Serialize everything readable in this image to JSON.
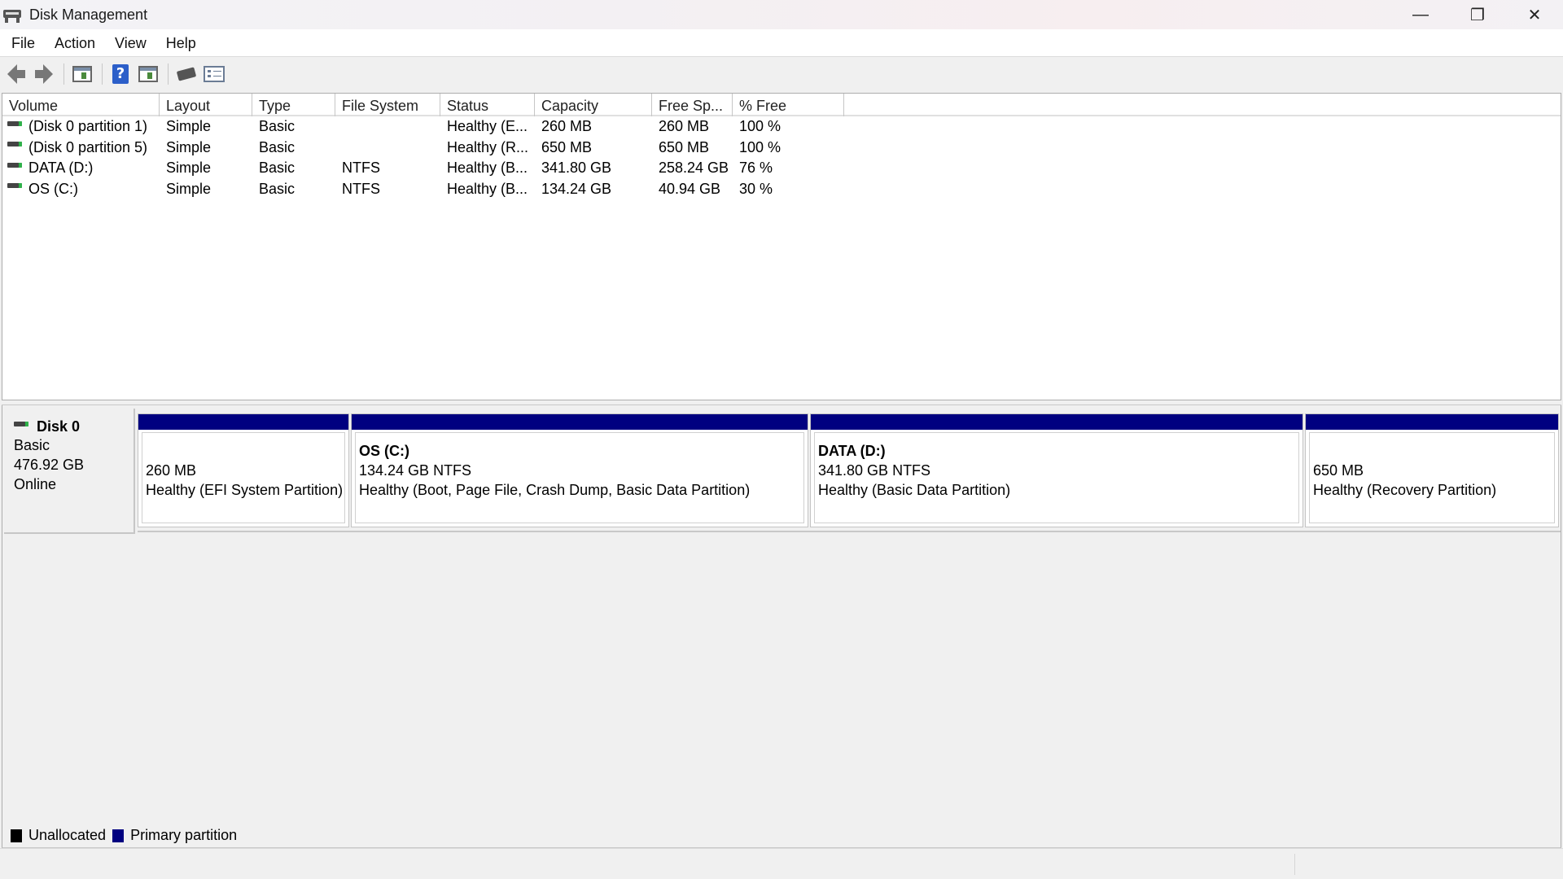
{
  "window": {
    "title": "Disk Management",
    "controls": {
      "minimize": "—",
      "restore": "❐",
      "close": "✕"
    }
  },
  "menu": [
    "File",
    "Action",
    "View",
    "Help"
  ],
  "toolbar": {
    "icons": [
      "back-arrow-icon",
      "forward-arrow-icon",
      "show-hide-console-tree-icon",
      "help-icon",
      "show-action-pane-icon",
      "connect-disk-icon",
      "properties-icon"
    ]
  },
  "volume_list": {
    "columns": [
      "Volume",
      "Layout",
      "Type",
      "File System",
      "Status",
      "Capacity",
      "Free Sp...",
      "% Free"
    ],
    "rows": [
      [
        "(Disk 0 partition 1)",
        "Simple",
        "Basic",
        "",
        "Healthy (E...",
        "260 MB",
        "260 MB",
        "100 %"
      ],
      [
        "(Disk 0 partition 5)",
        "Simple",
        "Basic",
        "",
        "Healthy (R...",
        "650 MB",
        "650 MB",
        "100 %"
      ],
      [
        "DATA (D:)",
        "Simple",
        "Basic",
        "NTFS",
        "Healthy (B...",
        "341.80 GB",
        "258.24 GB",
        "76 %"
      ],
      [
        "OS (C:)",
        "Simple",
        "Basic",
        "NTFS",
        "Healthy (B...",
        "134.24 GB",
        "40.94 GB",
        "30 %"
      ]
    ]
  },
  "disk": {
    "name": "Disk 0",
    "type": "Basic",
    "size": "476.92 GB",
    "status": "Online",
    "partitions": [
      {
        "name": "",
        "size": "260 MB",
        "status": "Healthy (EFI System Partition)"
      },
      {
        "name": "OS  (C:)",
        "size": "134.24 GB NTFS",
        "status": "Healthy (Boot, Page File, Crash Dump, Basic Data Partition)"
      },
      {
        "name": "DATA  (D:)",
        "size": "341.80 GB NTFS",
        "status": "Healthy (Basic Data Partition)"
      },
      {
        "name": "",
        "size": "650 MB",
        "status": "Healthy (Recovery Partition)"
      }
    ]
  },
  "legend": [
    {
      "label": "Unallocated",
      "color": "#000000"
    },
    {
      "label": "Primary partition",
      "color": "#000080"
    }
  ],
  "colors": {
    "primary_partition": "#000080",
    "unallocated": "#000000"
  }
}
